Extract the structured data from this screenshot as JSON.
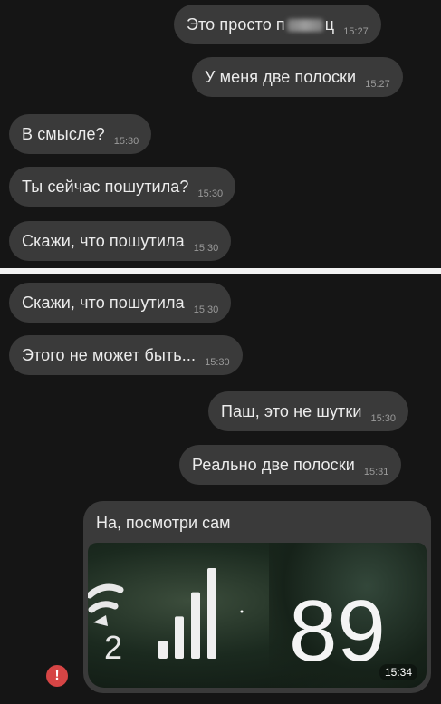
{
  "top_messages": [
    {
      "text_before": "Это просто п",
      "text_after": "ц",
      "time": "15:27",
      "side": "out"
    },
    {
      "text": "У меня две полоски",
      "time": "15:27",
      "side": "out"
    },
    {
      "text": "В смысле?",
      "time": "15:30",
      "side": "in"
    },
    {
      "text": "Ты сейчас пошутила?",
      "time": "15:30",
      "side": "in"
    },
    {
      "text": "Скажи, что пошутила",
      "time": "15:30",
      "side": "in"
    }
  ],
  "bottom_messages": [
    {
      "text": "Скажи, что пошутила",
      "time": "15:30",
      "side": "in"
    },
    {
      "text": "Этого не может быть...",
      "time": "15:30",
      "side": "in"
    },
    {
      "text": "Паш, это не шутки",
      "time": "15:30",
      "side": "out"
    },
    {
      "text": "Реально две полоски",
      "time": "15:31",
      "side": "out"
    }
  ],
  "photo_message": {
    "caption": "На, посмотри сам",
    "time": "15:34",
    "photo_text": "89",
    "photo_network_label": "2",
    "signal_bars_level": 1.0
  },
  "error_badge": {
    "symbol": "!",
    "color": "#d64545"
  },
  "colors": {
    "background": "#151515",
    "bubble": "#3a3a3a",
    "divider": "#f2f2f2"
  }
}
